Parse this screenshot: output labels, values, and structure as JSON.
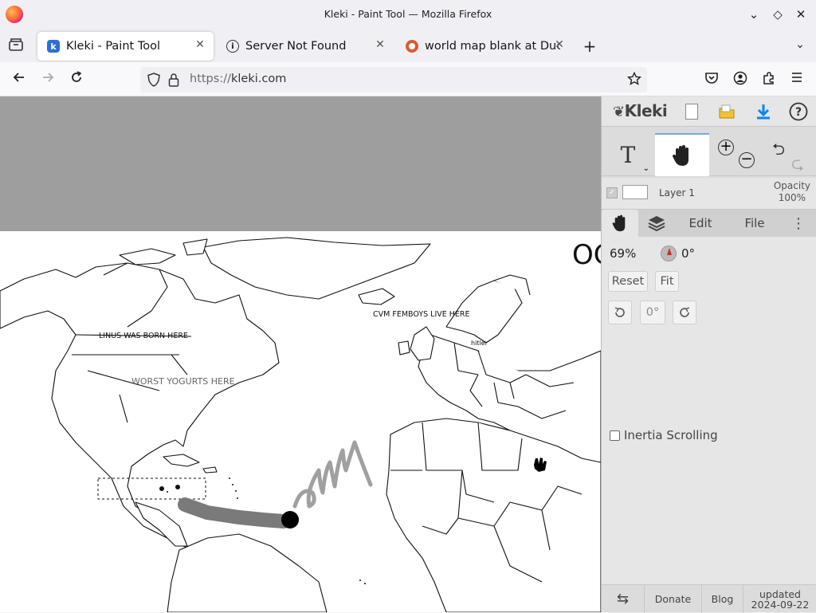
{
  "window": {
    "title": "Kleki - Paint Tool — Mozilla Firefox"
  },
  "tabs": [
    {
      "label": "Kleki - Paint Tool",
      "icon": "kleki-icon",
      "active": true
    },
    {
      "label": "Server Not Found",
      "icon": "info-icon",
      "active": false
    },
    {
      "label": "world map blank at Duck",
      "icon": "duckduckgo-icon",
      "active": false
    }
  ],
  "navbar": {
    "url_prefix": "https://",
    "url_host": "kleki.com"
  },
  "map": {
    "labels": {
      "linus": "LINUS WAS BORN HERE",
      "worst": "WORST YOGURTS HERE",
      "cvm": "CVM FEMBOYS LIVE HERE",
      "hitler": "hitler",
      "big_text": "OC"
    }
  },
  "kleki": {
    "logo": "Kleki",
    "layer": {
      "name": "Layer 1",
      "opacity_label": "Opacity",
      "opacity_value": "100%"
    },
    "tabs": {
      "edit": "Edit",
      "file": "File"
    },
    "hand": {
      "zoom": "69%",
      "angle": "0°",
      "reset": "Reset",
      "fit": "Fit",
      "rotate_value": "0°",
      "inertia_label": "Inertia Scrolling"
    },
    "footer": {
      "donate": "Donate",
      "blog": "Blog",
      "updated": "updated",
      "date": "2024-09-22"
    }
  },
  "colors": {
    "accent_blue": "#0a84ff",
    "canvas_bg": "#9e9e9e",
    "panel_bg": "#dcdcdc"
  }
}
